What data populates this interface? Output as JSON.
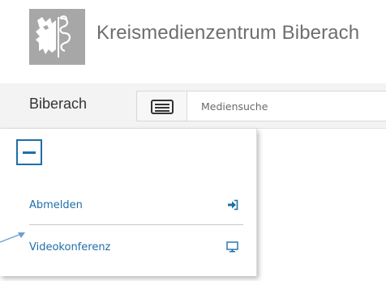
{
  "header": {
    "title": "Kreismedienzentrum Biberach",
    "logo_icon": "coat-of-arms-icon",
    "logo_color": "#a7a7a7"
  },
  "navbar": {
    "brand": "Biberach",
    "menu_icon": "list-icon",
    "search": {
      "placeholder": "Mediensuche",
      "value": ""
    }
  },
  "dropdown": {
    "collapse_icon": "minus-icon",
    "items": [
      {
        "label": "Abmelden",
        "icon": "sign-out-icon"
      },
      {
        "label": "Videokonferenz",
        "icon": "monitor-icon"
      }
    ]
  },
  "colors": {
    "accent": "#1f6ea8",
    "title_gray": "#6e6e6e",
    "navbar_bg": "#f3f3f3",
    "annotation_arrow": "#6b9fd6"
  }
}
